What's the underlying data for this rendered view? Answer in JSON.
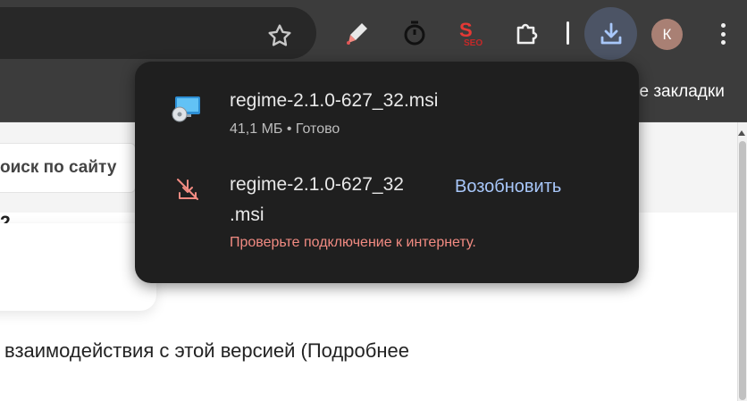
{
  "bookmarks_bar": {
    "text": "се закладки"
  },
  "page": {
    "search_placeholder": "оиск по сайту",
    "number_fragment": "2",
    "body_text": "взаимодействия с этой версией (Подробнее"
  },
  "toolbar": {
    "avatar_letter": "К",
    "seo_label": "SEO"
  },
  "downloads": {
    "items": [
      {
        "filename": "regime-2.1.0-627_32.msi",
        "meta": "41,1 МБ • Готово",
        "icon": "installer-file-icon"
      },
      {
        "filename_line1": "regime-2.1.0-627_32",
        "filename_line2": ".msi",
        "error": "Проверьте подключение к интернету.",
        "action": "Возобновить",
        "icon": "download-failed-icon"
      }
    ]
  },
  "colors": {
    "error": "#f28b82",
    "action": "#a8c7fa",
    "panel": "#1f1f1f",
    "download_button_bg": "#4c5465"
  }
}
